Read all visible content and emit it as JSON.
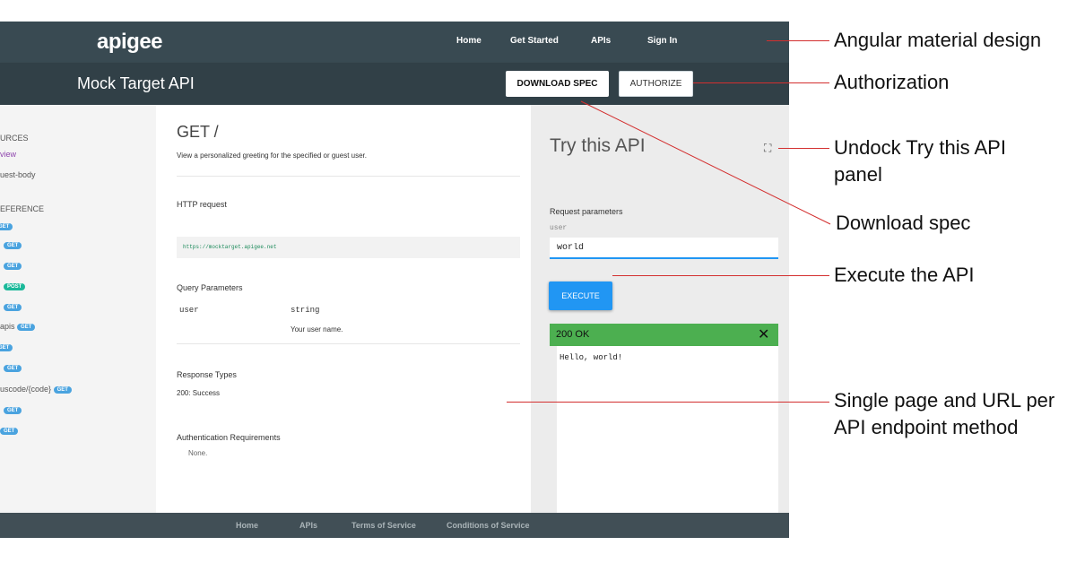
{
  "header": {
    "logo": "apigee",
    "nav": [
      "Home",
      "Get Started",
      "APIs",
      "Sign In"
    ]
  },
  "subheader": {
    "title": "Mock Target API",
    "download_label": "DOWNLOAD SPEC",
    "authorize_label": "AUTHORIZE"
  },
  "sidebar": {
    "section_resources": "URCES",
    "item_overview": "view",
    "item_request_body": "uest-body",
    "section_reference": "EFERENCE",
    "item_apis": "apis",
    "item_statuscode": "uscode/{code}",
    "badge_get": "GET",
    "badge_post": "POST"
  },
  "main": {
    "method_title": "GET /",
    "description": "View a personalized greeting for the specified or guest user.",
    "http_request_label": "HTTP request",
    "http_url": "https://mocktarget.apigee.net",
    "query_params_label": "Query Parameters",
    "param_name": "user",
    "param_type": "string",
    "param_desc": "Your user name.",
    "response_types_label": "Response Types",
    "response_type": "200: Success",
    "auth_label": "Authentication Requirements",
    "auth_value": "None."
  },
  "try_panel": {
    "title": "Try this API",
    "request_params_label": "Request parameters",
    "field_label": "user",
    "field_value": "world",
    "execute_label": "EXECUTE",
    "status": "200 OK",
    "response_body": "Hello, world!"
  },
  "footer": {
    "links": [
      "Home",
      "APIs",
      "Terms of Service",
      "Conditions of Service"
    ]
  },
  "annotations": [
    {
      "text": "Angular material design"
    },
    {
      "text": "Authorization"
    },
    {
      "text": "Undock Try this API panel"
    },
    {
      "text": "Download spec"
    },
    {
      "text": "Execute the API"
    },
    {
      "text": "Single page and URL per API endpoint method"
    }
  ],
  "colors": {
    "topbar": "#394a52",
    "subbar": "#314047",
    "accent_blue": "#2196f3",
    "success_green": "#4caf50",
    "annotation_red": "#d32f2f"
  },
  "icons": {
    "undock": "undock-icon",
    "close": "close-icon"
  }
}
